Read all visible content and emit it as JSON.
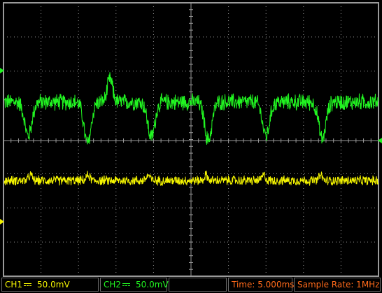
{
  "status": {
    "ch1": {
      "label": "CH1",
      "coupling_icon": "dc-coupling-icon",
      "scale": "50.0mV",
      "color": "#f4f400"
    },
    "ch2": {
      "label": "CH2",
      "coupling_icon": "dc-coupling-icon",
      "scale": "50.0mV",
      "color": "#21f521"
    },
    "time": "Time: 5.000ms",
    "sample_rate": "Sample Rate: 1MHz"
  },
  "colors": {
    "background": "#000000",
    "grid": "#9a9a9a",
    "ch1_trace": "#f4f400",
    "ch2_trace": "#21f521",
    "status_text": "#ff6a1a"
  },
  "ch2_trace": {
    "baseline_div": 2.4,
    "noise_div": 0.5,
    "dips": [
      {
        "t_div": 0.33,
        "depth_div": 2.1
      },
      {
        "t_div": 1.12,
        "depth_div": 2.6
      },
      {
        "t_div": 1.97,
        "depth_div": 2.2
      },
      {
        "t_div": 2.73,
        "depth_div": 2.4
      },
      {
        "t_div": 3.5,
        "depth_div": 2.1
      },
      {
        "t_div": 4.25,
        "depth_div": 2.3
      }
    ],
    "peak": {
      "t_div": 1.42,
      "height_div": 1.4
    }
  },
  "ch1_trace": {
    "baseline_div": -2.6,
    "noise_div": 0.3,
    "bumps_t_div": [
      0.36,
      1.13,
      1.93,
      2.7,
      3.47,
      4.23
    ]
  }
}
